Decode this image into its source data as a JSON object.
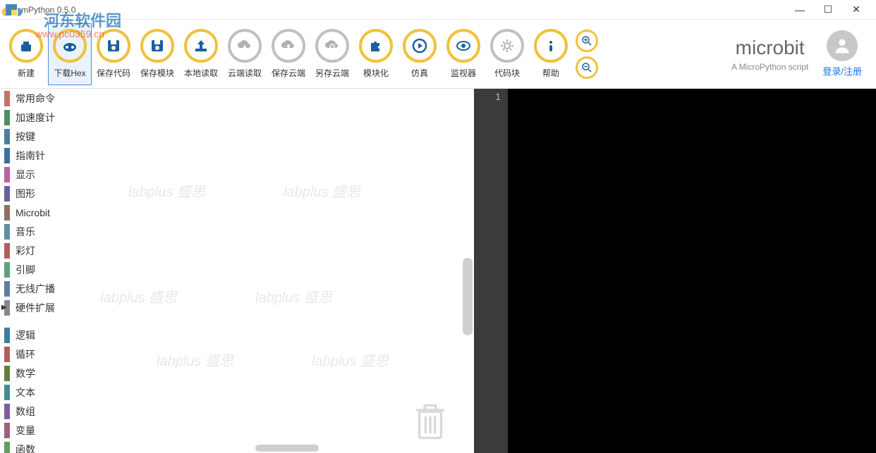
{
  "window": {
    "title": "mPython 0.5.0"
  },
  "toolbar": [
    {
      "id": "new",
      "label": "新建",
      "ring": "yellow",
      "icon": "new"
    },
    {
      "id": "download-hex",
      "label": "下载Hex",
      "ring": "yellow",
      "icon": "download",
      "highlight": true
    },
    {
      "id": "save-code",
      "label": "保存代码",
      "ring": "yellow",
      "icon": "save"
    },
    {
      "id": "save-block",
      "label": "保存模块",
      "ring": "yellow",
      "icon": "save"
    },
    {
      "id": "local-load",
      "label": "本地读取",
      "ring": "yellow",
      "icon": "upload"
    },
    {
      "id": "cloud-load",
      "label": "云端读取",
      "ring": "gray",
      "icon": "cloud-down"
    },
    {
      "id": "save-cloud",
      "label": "保存云端",
      "ring": "gray",
      "icon": "cloud-up"
    },
    {
      "id": "saveas-cloud",
      "label": "另存云端",
      "ring": "gray",
      "icon": "cloud-link"
    },
    {
      "id": "blockify",
      "label": "模块化",
      "ring": "yellow",
      "icon": "puzzle"
    },
    {
      "id": "simulate",
      "label": "仿真",
      "ring": "yellow",
      "icon": "play"
    },
    {
      "id": "monitor",
      "label": "监视器",
      "ring": "yellow",
      "icon": "eye"
    },
    {
      "id": "codeblock",
      "label": "代码块",
      "ring": "gray",
      "icon": "gear"
    },
    {
      "id": "help",
      "label": "帮助",
      "ring": "yellow",
      "icon": "info"
    }
  ],
  "brand": {
    "title": "microbit",
    "subtitle": "A MicroPython script"
  },
  "user": {
    "login_label": "登录/注册"
  },
  "sidebar_groups": [
    [
      {
        "label": "常用命令",
        "color": "#c96f6f"
      },
      {
        "label": "加速度计",
        "color": "#4a8f5e"
      },
      {
        "label": "按键",
        "color": "#4a7f9f"
      },
      {
        "label": "指南针",
        "color": "#3a6fa0"
      },
      {
        "label": "显示",
        "color": "#bf5f9f"
      },
      {
        "label": "图形",
        "color": "#6b5f9f"
      },
      {
        "label": "Microbit",
        "color": "#8f6f5f"
      },
      {
        "label": "音乐",
        "color": "#5f8f9f"
      },
      {
        "label": "彩灯",
        "color": "#b05f5f"
      },
      {
        "label": "引脚",
        "color": "#5f9f7f"
      },
      {
        "label": "无线广播",
        "color": "#5f7f9f"
      },
      {
        "label": "硬件扩展",
        "color": "#888888",
        "arrow": true
      }
    ],
    [
      {
        "label": "逻辑",
        "color": "#3a7f9f"
      },
      {
        "label": "循环",
        "color": "#b05f5f"
      },
      {
        "label": "数学",
        "color": "#5f7f3f"
      },
      {
        "label": "文本",
        "color": "#3f8f8f"
      },
      {
        "label": "数组",
        "color": "#7f5f9f"
      },
      {
        "label": "变量",
        "color": "#9f5f7f"
      },
      {
        "label": "函数",
        "color": "#5f9f5f"
      }
    ]
  ],
  "editor": {
    "line_numbers": [
      "1"
    ],
    "content": ""
  },
  "watermark": {
    "site_name": "河东软件园",
    "url": "www.pc0359.cn",
    "canvas_mark": "labplus 盛思"
  }
}
